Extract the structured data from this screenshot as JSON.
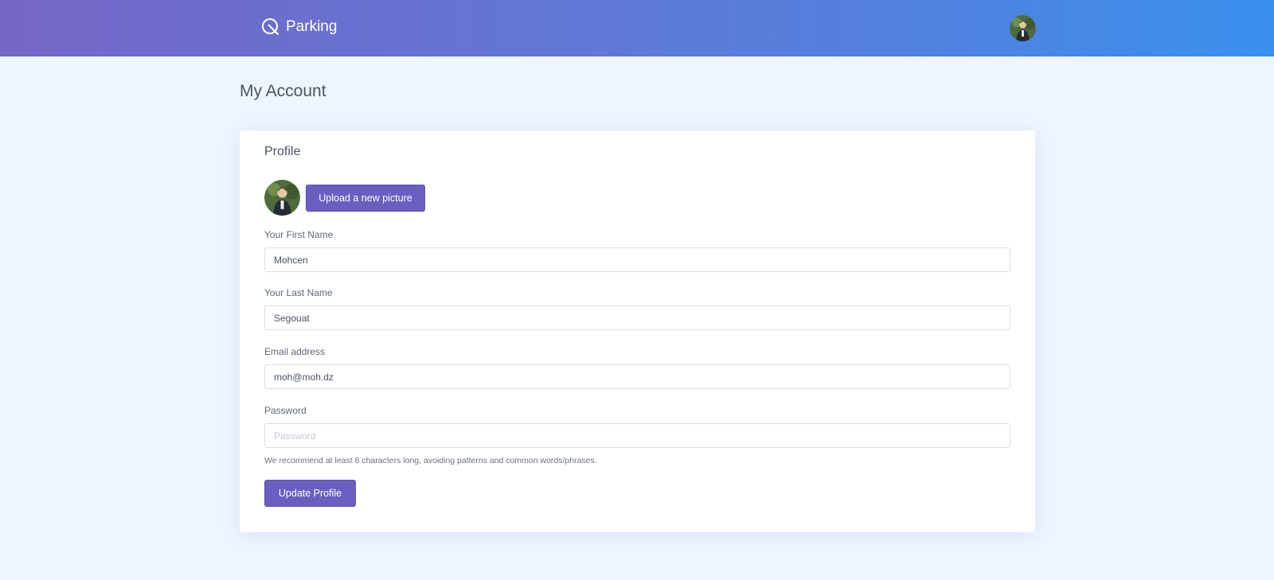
{
  "header": {
    "brand_name": "Parking",
    "brand_icon": "parking-logo-icon"
  },
  "page": {
    "title": "My Account"
  },
  "profile": {
    "title": "Profile",
    "upload_label": "Upload a new picture",
    "fields": [
      {
        "label": "Your First Name",
        "value": "Mohcen",
        "placeholder": ""
      },
      {
        "label": "Your Last Name",
        "value": "Segouat",
        "placeholder": ""
      },
      {
        "label": "Email address",
        "value": "moh@moh.dz",
        "placeholder": ""
      },
      {
        "label": "Password",
        "value": "",
        "placeholder": "Password"
      }
    ],
    "password_help": "We recommend at least 8 characters long, avoiding patterns and common words/phrases.",
    "update_label": "Update Profile"
  },
  "colors": {
    "header_gradient_start": "#7566c6",
    "header_gradient_end": "#3a90ee",
    "primary_button": "#6a5fc1",
    "page_background": "#eef5fe"
  }
}
